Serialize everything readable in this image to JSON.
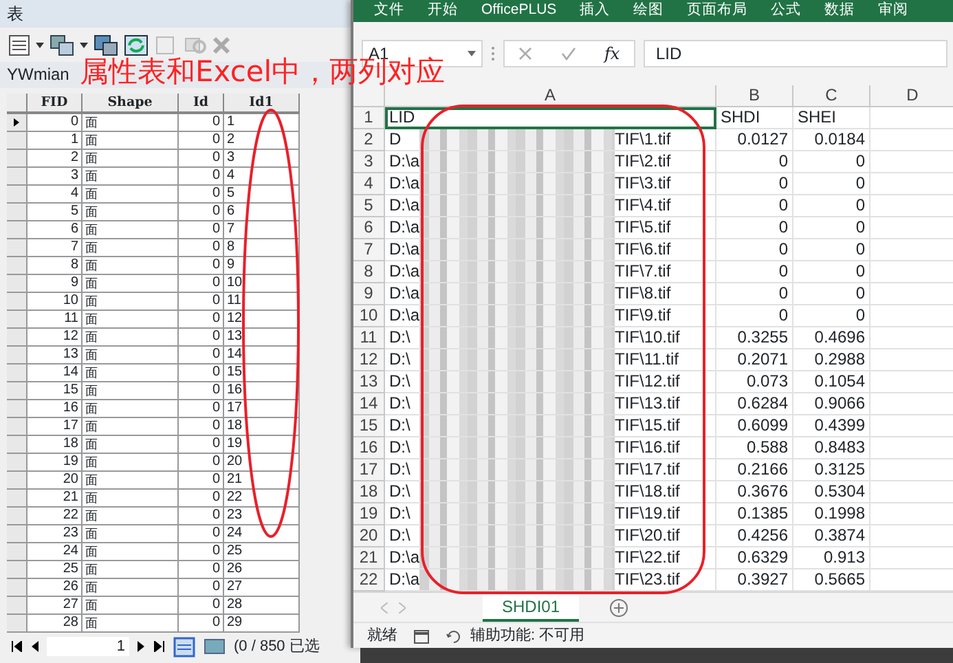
{
  "attribute_table": {
    "title": "表",
    "table_name": "YWmian",
    "columns": [
      "FID",
      "Shape",
      "Id",
      "Id1"
    ],
    "rows": [
      {
        "current": true,
        "cells": [
          "0",
          "面",
          "0",
          "1"
        ]
      },
      {
        "current": false,
        "cells": [
          "1",
          "面",
          "0",
          "2"
        ]
      },
      {
        "current": false,
        "cells": [
          "2",
          "面",
          "0",
          "3"
        ]
      },
      {
        "current": false,
        "cells": [
          "3",
          "面",
          "0",
          "4"
        ]
      },
      {
        "current": false,
        "cells": [
          "4",
          "面",
          "0",
          "5"
        ]
      },
      {
        "current": false,
        "cells": [
          "5",
          "面",
          "0",
          "6"
        ]
      },
      {
        "current": false,
        "cells": [
          "6",
          "面",
          "0",
          "7"
        ]
      },
      {
        "current": false,
        "cells": [
          "7",
          "面",
          "0",
          "8"
        ]
      },
      {
        "current": false,
        "cells": [
          "8",
          "面",
          "0",
          "9"
        ]
      },
      {
        "current": false,
        "cells": [
          "9",
          "面",
          "0",
          "10"
        ]
      },
      {
        "current": false,
        "cells": [
          "10",
          "面",
          "0",
          "11"
        ]
      },
      {
        "current": false,
        "cells": [
          "11",
          "面",
          "0",
          "12"
        ]
      },
      {
        "current": false,
        "cells": [
          "12",
          "面",
          "0",
          "13"
        ]
      },
      {
        "current": false,
        "cells": [
          "13",
          "面",
          "0",
          "14"
        ]
      },
      {
        "current": false,
        "cells": [
          "14",
          "面",
          "0",
          "15"
        ]
      },
      {
        "current": false,
        "cells": [
          "15",
          "面",
          "0",
          "16"
        ]
      },
      {
        "current": false,
        "cells": [
          "16",
          "面",
          "0",
          "17"
        ]
      },
      {
        "current": false,
        "cells": [
          "17",
          "面",
          "0",
          "18"
        ]
      },
      {
        "current": false,
        "cells": [
          "18",
          "面",
          "0",
          "19"
        ]
      },
      {
        "current": false,
        "cells": [
          "19",
          "面",
          "0",
          "20"
        ]
      },
      {
        "current": false,
        "cells": [
          "20",
          "面",
          "0",
          "21"
        ]
      },
      {
        "current": false,
        "cells": [
          "21",
          "面",
          "0",
          "22"
        ]
      },
      {
        "current": false,
        "cells": [
          "22",
          "面",
          "0",
          "23"
        ]
      },
      {
        "current": false,
        "cells": [
          "23",
          "面",
          "0",
          "24"
        ]
      },
      {
        "current": false,
        "cells": [
          "24",
          "面",
          "0",
          "25"
        ]
      },
      {
        "current": false,
        "cells": [
          "25",
          "面",
          "0",
          "26"
        ]
      },
      {
        "current": false,
        "cells": [
          "26",
          "面",
          "0",
          "27"
        ]
      },
      {
        "current": false,
        "cells": [
          "27",
          "面",
          "0",
          "28"
        ]
      },
      {
        "current": false,
        "cells": [
          "28",
          "面",
          "0",
          "29"
        ]
      }
    ],
    "page": "1",
    "selection": "(0 / 850 已选"
  },
  "excel": {
    "ribbon_tabs": [
      "文件",
      "开始",
      "OfficePLUS",
      "插入",
      "绘图",
      "页面布局",
      "公式",
      "数据",
      "审阅"
    ],
    "name_box": "A1",
    "fx": "fx",
    "formula": "LID",
    "column_headers": [
      "A",
      "B",
      "C",
      "D"
    ],
    "rows": [
      {
        "number": "1",
        "kind": "header",
        "selected": true,
        "a": "LID",
        "b": "SHDI",
        "c": "SHEI"
      },
      {
        "number": "2",
        "kind": "data",
        "selected": false,
        "a_start": "D",
        "a_end": "TIF\\1.tif",
        "b": "0.0127",
        "c": "0.0184"
      },
      {
        "number": "3",
        "kind": "data",
        "selected": false,
        "a_start": "D:\\a",
        "a_end": "TIF\\2.tif",
        "b": "0",
        "c": "0"
      },
      {
        "number": "4",
        "kind": "data",
        "selected": false,
        "a_start": "D:\\a",
        "a_end": "TIF\\3.tif",
        "b": "0",
        "c": "0"
      },
      {
        "number": "5",
        "kind": "data",
        "selected": false,
        "a_start": "D:\\a",
        "a_end": "TIF\\4.tif",
        "b": "0",
        "c": "0"
      },
      {
        "number": "6",
        "kind": "data",
        "selected": false,
        "a_start": "D:\\a",
        "a_end": "TIF\\5.tif",
        "b": "0",
        "c": "0"
      },
      {
        "number": "7",
        "kind": "data",
        "selected": false,
        "a_start": "D:\\a",
        "a_end": "TIF\\6.tif",
        "b": "0",
        "c": "0"
      },
      {
        "number": "8",
        "kind": "data",
        "selected": false,
        "a_start": "D:\\a",
        "a_end": "TIF\\7.tif",
        "b": "0",
        "c": "0"
      },
      {
        "number": "9",
        "kind": "data",
        "selected": false,
        "a_start": "D:\\a",
        "a_end": "TIF\\8.tif",
        "b": "0",
        "c": "0"
      },
      {
        "number": "10",
        "kind": "data",
        "selected": false,
        "a_start": "D:\\a",
        "a_end": "TIF\\9.tif",
        "b": "0",
        "c": "0"
      },
      {
        "number": "11",
        "kind": "data",
        "selected": false,
        "a_start": "D:\\",
        "a_end": "TIF\\10.tif",
        "b": "0.3255",
        "c": "0.4696"
      },
      {
        "number": "12",
        "kind": "data",
        "selected": false,
        "a_start": "D:\\",
        "a_end": "TIF\\11.tif",
        "b": "0.2071",
        "c": "0.2988"
      },
      {
        "number": "13",
        "kind": "data",
        "selected": false,
        "a_start": "D:\\",
        "a_end": "TIF\\12.tif",
        "b": "0.073",
        "c": "0.1054"
      },
      {
        "number": "14",
        "kind": "data",
        "selected": false,
        "a_start": "D:\\",
        "a_end": "TIF\\13.tif",
        "b": "0.6284",
        "c": "0.9066"
      },
      {
        "number": "15",
        "kind": "data",
        "selected": false,
        "a_start": "D:\\",
        "a_end": "TIF\\15.tif",
        "b": "0.6099",
        "c": "0.4399"
      },
      {
        "number": "16",
        "kind": "data",
        "selected": false,
        "a_start": "D:\\",
        "a_end": "TIF\\16.tif",
        "b": "0.588",
        "c": "0.8483"
      },
      {
        "number": "17",
        "kind": "data",
        "selected": false,
        "a_start": "D:\\",
        "a_end": "TIF\\17.tif",
        "b": "0.2166",
        "c": "0.3125"
      },
      {
        "number": "18",
        "kind": "data",
        "selected": false,
        "a_start": "D:\\",
        "a_end": "TIF\\18.tif",
        "b": "0.3676",
        "c": "0.5304"
      },
      {
        "number": "19",
        "kind": "data",
        "selected": false,
        "a_start": "D:\\",
        "a_end": "TIF\\19.tif",
        "b": "0.1385",
        "c": "0.1998"
      },
      {
        "number": "20",
        "kind": "data",
        "selected": false,
        "a_start": "D:\\",
        "a_end": "TIF\\20.tif",
        "b": "0.4256",
        "c": "0.3874"
      },
      {
        "number": "21",
        "kind": "data",
        "selected": false,
        "a_start": "D:\\a",
        "a_end": "TIF\\22.tif",
        "b": "0.6329",
        "c": "0.913"
      },
      {
        "number": "22",
        "kind": "data",
        "selected": false,
        "a_start": "D:\\a",
        "a_end": "TIF\\23.tif",
        "b": "0.3927",
        "c": "0.5665"
      }
    ],
    "sheet_tabs": [
      {
        "label": "SHDI01",
        "selected": true
      }
    ],
    "status": {
      "ready": "就绪",
      "accessibility": "辅助功能: 不可用"
    }
  },
  "annotation": {
    "text": "属性表和Excel中，两列对应"
  }
}
